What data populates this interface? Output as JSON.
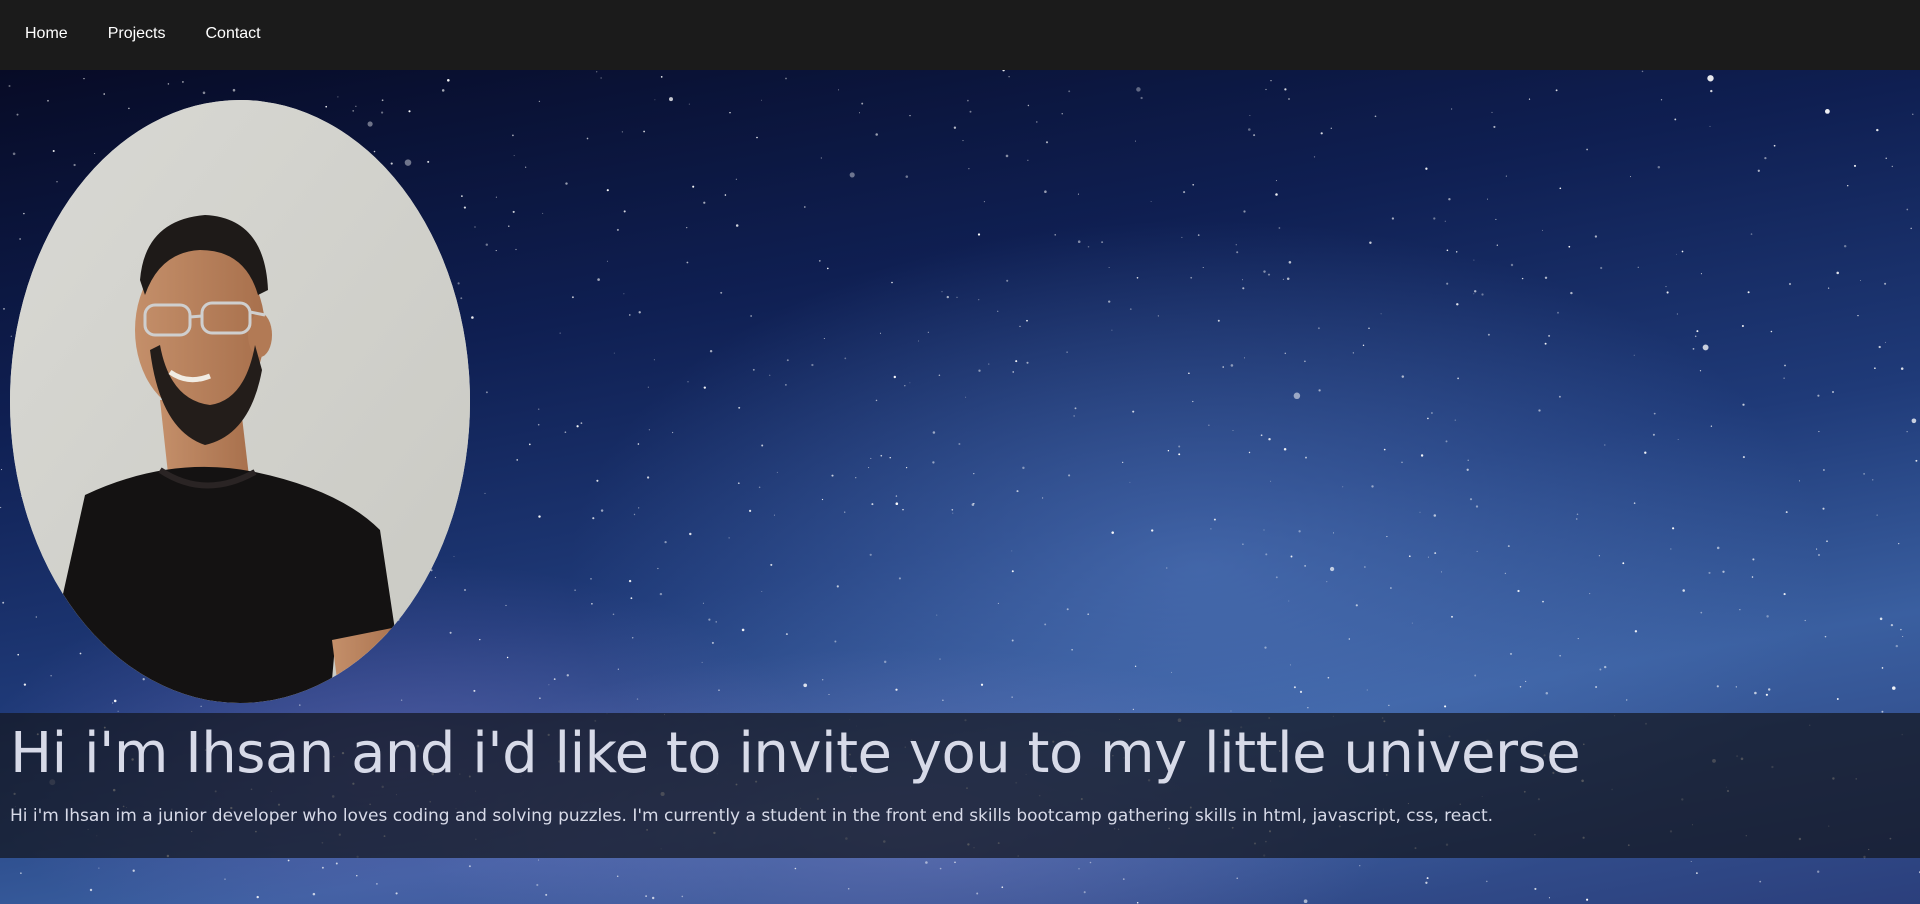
{
  "nav": {
    "items": [
      {
        "label": "Home"
      },
      {
        "label": "Projects"
      },
      {
        "label": "Contact"
      }
    ]
  },
  "hero": {
    "headline": "Hi i'm Ihsan and i'd like to invite you to my little universe",
    "description": "Hi i'm Ihsan im a junior developer who loves coding and solving puzzles. I'm currently a student in the front end skills bootcamp gathering skills in html, javascript, css, react."
  },
  "colors": {
    "navbar": "#1b1b1b",
    "text": "#d7dae8",
    "sky_dark": "#070b26",
    "sky_light": "#3a5fa0"
  }
}
